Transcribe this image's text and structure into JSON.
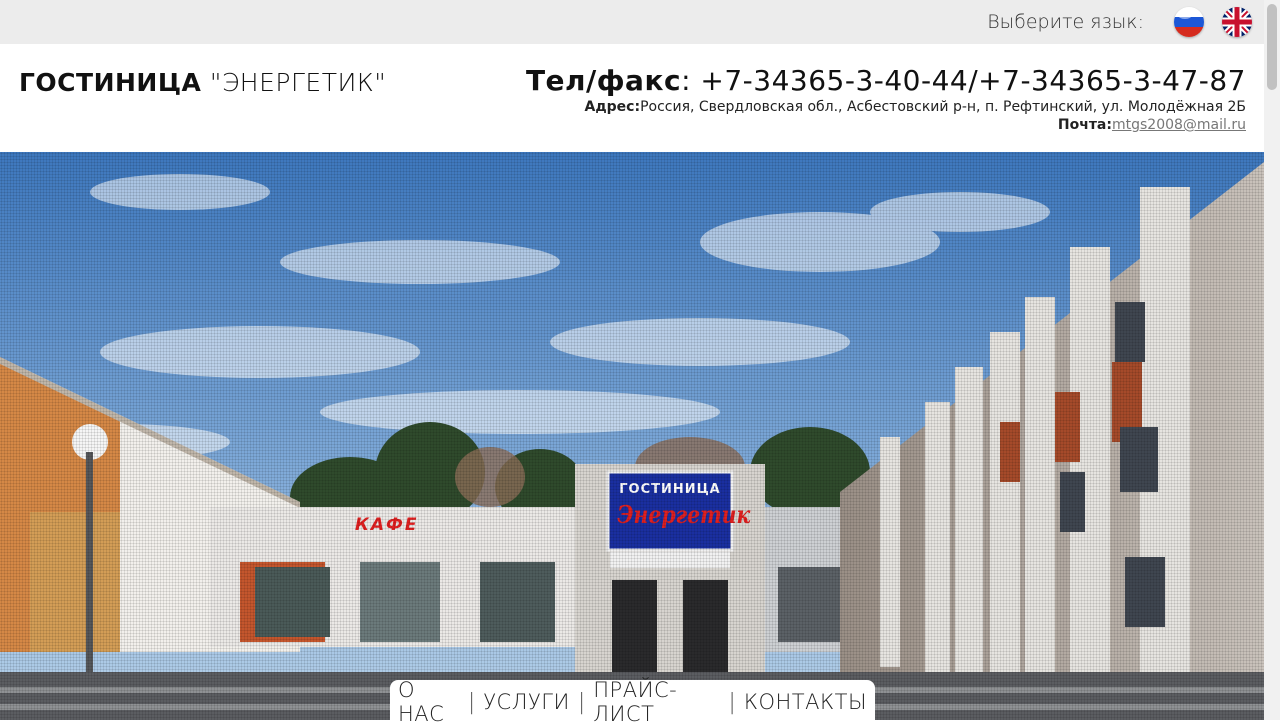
{
  "lang": {
    "label": "Выберите язык:",
    "options": [
      {
        "icon": "russia-flag-icon",
        "colors": [
          "#ffffff",
          "#1c57d6",
          "#d52b1e"
        ]
      },
      {
        "icon": "uk-flag-icon",
        "colors": [
          "#012169",
          "#ffffff",
          "#c8102e"
        ]
      }
    ]
  },
  "header": {
    "brand_bold": "ГОСТИНИЦА",
    "brand_light": " \"ЭНЕРГЕТИК\"",
    "phone_label": "Тел/факс",
    "phone_value": ": +7-34365-3-40-44/+7-34365-3-47-87",
    "address_label": "Адрес:",
    "address_value": "Россия, Свердловская обл., Асбестовский р-н, п. Рефтинский, ул. Молодёжная 2Б",
    "mail_label": "Почта:",
    "mail_value": "mtgs2008@mail.ru"
  },
  "hero": {
    "sign_top": "ГОСТИНИЦА",
    "sign_main": "Энергетик",
    "cafe_sign": "КАФЕ"
  },
  "nav": {
    "items": [
      "О НАС",
      "УСЛУГИ",
      "ПРАЙС-ЛИСТ",
      "КОНТАКТЫ"
    ]
  },
  "colors": {
    "sky_top": "#3d77bd",
    "sky_bottom": "#b9d3ea",
    "sign_blue": "#1a2fa0",
    "sign_red": "#e02020"
  }
}
